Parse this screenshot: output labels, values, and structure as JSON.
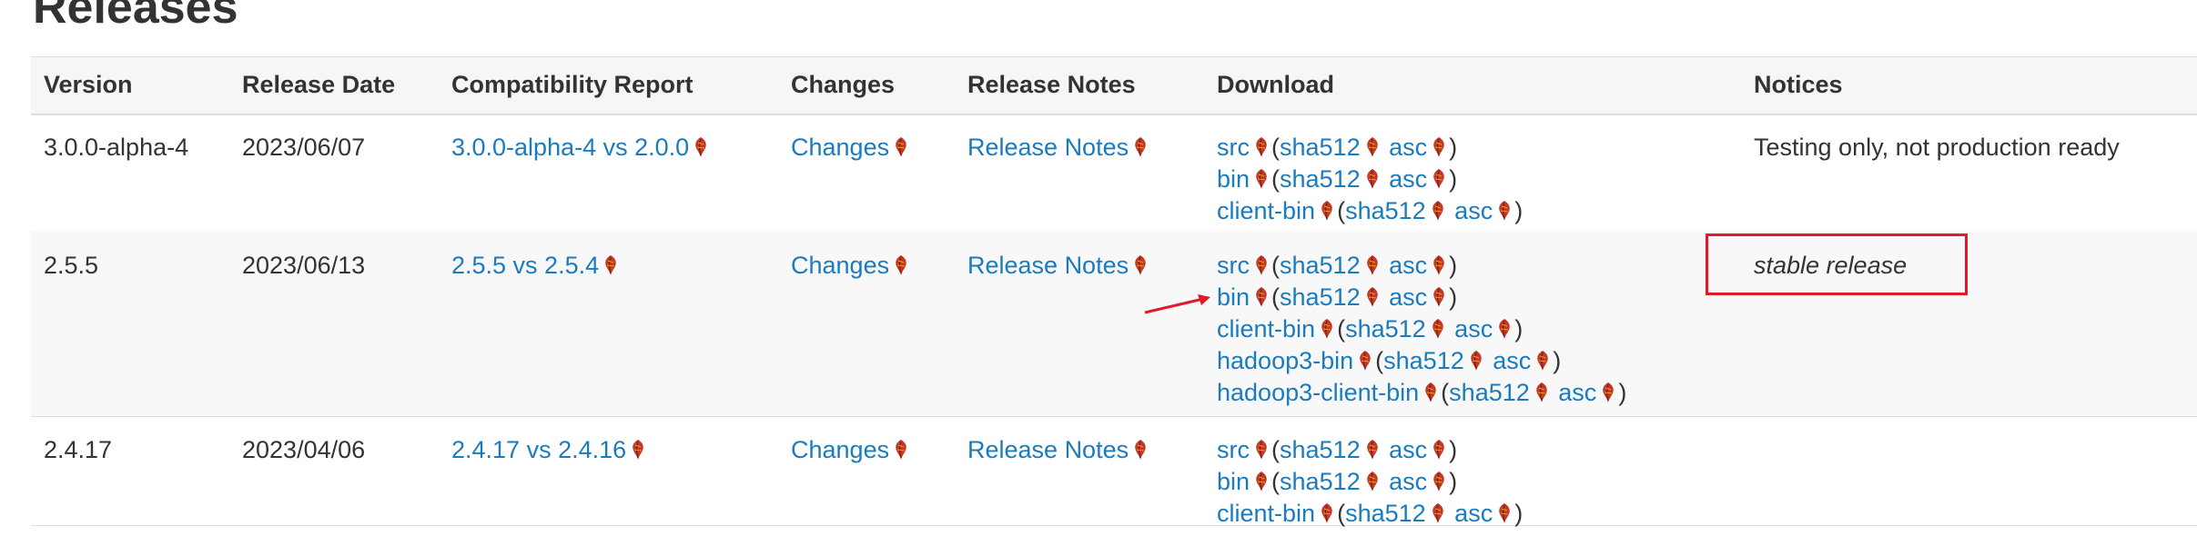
{
  "page": {
    "title": "Releases"
  },
  "table": {
    "headers": {
      "version": "Version",
      "release_date": "Release Date",
      "compatibility": "Compatibility Report",
      "changes": "Changes",
      "release_notes": "Release Notes",
      "download": "Download",
      "notices": "Notices"
    },
    "rows": [
      {
        "version": "3.0.0-alpha-4",
        "date": "2023/06/07",
        "compat": "3.0.0-alpha-4 vs 2.0.0",
        "changes": "Changes",
        "notes": "Release Notes",
        "downloads": [
          {
            "name": "src",
            "sha": "sha512",
            "asc": "asc"
          },
          {
            "name": "bin",
            "sha": "sha512",
            "asc": "asc"
          },
          {
            "name": "client-bin",
            "sha": "sha512",
            "asc": "asc"
          }
        ],
        "notice": "Testing only, not production ready"
      },
      {
        "version": "2.5.5",
        "date": "2023/06/13",
        "compat": "2.5.5 vs 2.5.4",
        "changes": "Changes",
        "notes": "Release Notes",
        "downloads": [
          {
            "name": "src",
            "sha": "sha512",
            "asc": "asc"
          },
          {
            "name": "bin",
            "sha": "sha512",
            "asc": "asc"
          },
          {
            "name": "client-bin",
            "sha": "sha512",
            "asc": "asc"
          },
          {
            "name": "hadoop3-bin",
            "sha": "sha512",
            "asc": "asc"
          },
          {
            "name": "hadoop3-client-bin",
            "sha": "sha512",
            "asc": "asc"
          }
        ],
        "notice": "stable release"
      },
      {
        "version": "2.4.17",
        "date": "2023/04/06",
        "compat": "2.4.17 vs 2.4.16",
        "changes": "Changes",
        "notes": "Release Notes",
        "downloads": [
          {
            "name": "src",
            "sha": "sha512",
            "asc": "asc"
          },
          {
            "name": "bin",
            "sha": "sha512",
            "asc": "asc"
          },
          {
            "name": "client-bin",
            "sha": "sha512",
            "asc": "asc"
          }
        ],
        "notice": ""
      }
    ]
  },
  "colors": {
    "link": "#1a7bbf",
    "badge": "#c0392b",
    "annotation": "#e0192b"
  },
  "icons": {
    "external_link": "apache-feather-badge-icon"
  }
}
